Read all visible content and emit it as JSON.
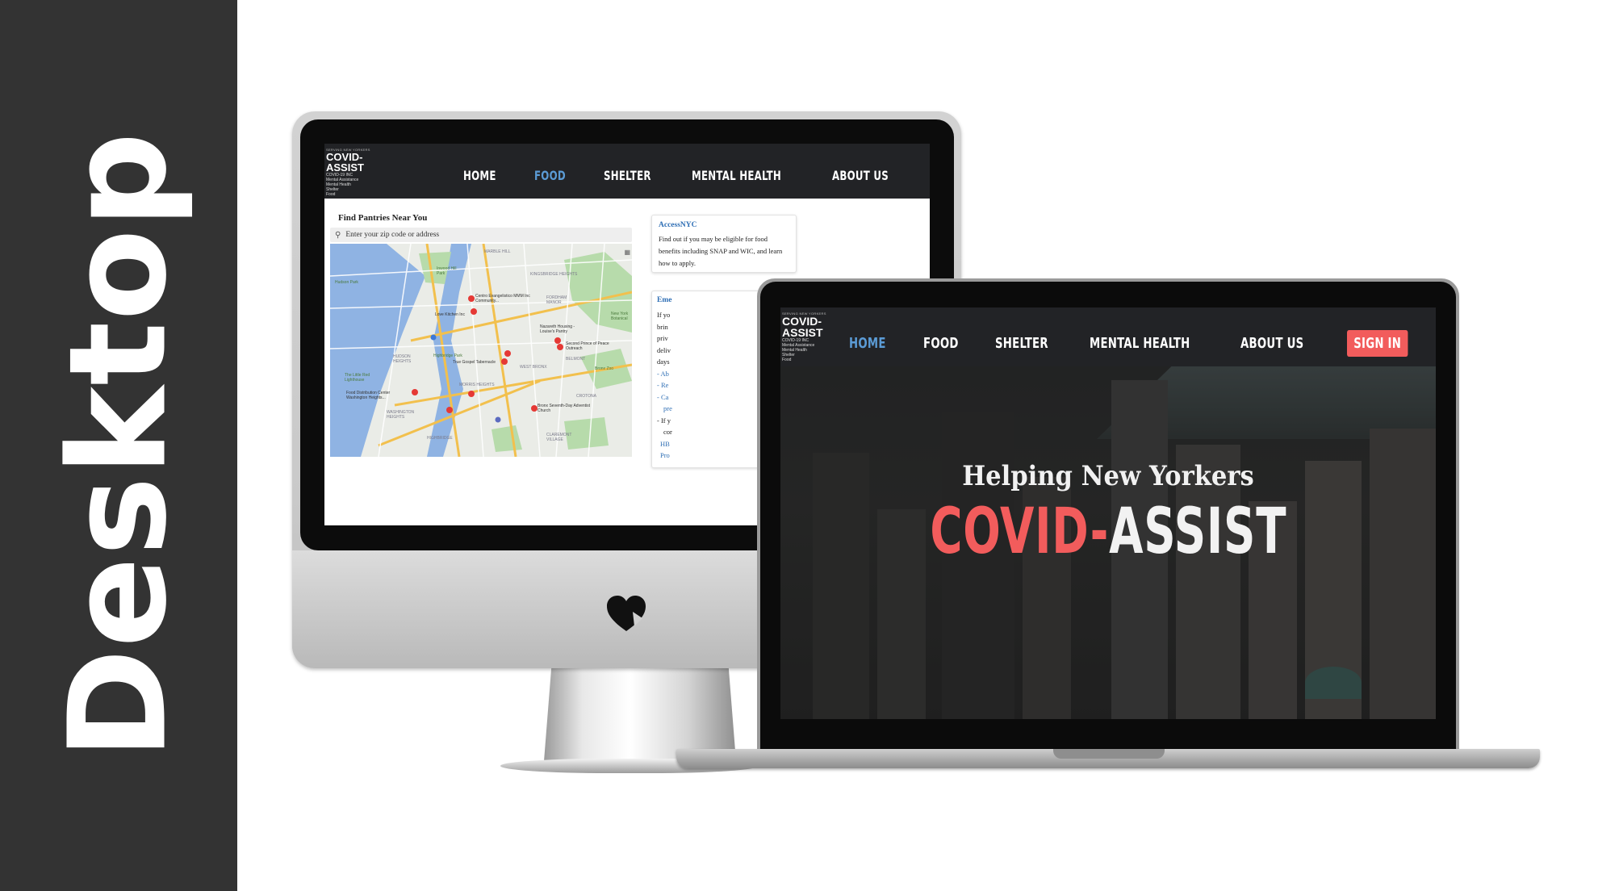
{
  "side_label": "Desktop",
  "colors": {
    "accent": "#f25c5c",
    "link": "#2f6fb5",
    "active_nav": "#5b9bd5",
    "nav_bg": "#222326",
    "band": "#333333"
  },
  "brand": {
    "tagline_top": "SERVING NEW YORKERS",
    "line1": "COVID-",
    "line2": "ASSIST",
    "line3": "COVID-19 INC",
    "small_lines": [
      "Mental Assistance",
      "Mental Health",
      "Shelter",
      "Food"
    ]
  },
  "imac": {
    "nav": [
      "HOME",
      "FOOD",
      "SHELTER",
      "MENTAL HEALTH",
      "ABOUT US"
    ],
    "active_nav": "FOOD",
    "find_title": "Find Pantries Near You",
    "search_placeholder": "Enter your zip code or address",
    "search_icon": "search-icon",
    "map_labels": [
      "MARBLE HILL",
      "Inwood Hill Park",
      "Hudson Park",
      "KINGSBRIDGE HEIGHTS",
      "FORDHAM MANOR",
      "Centro Evangelistico MMM Inc Community...",
      "Love Kitchen Inc",
      "Nazareth Housing - Louise's Pantry",
      "Second Prince of Peace Outreach",
      "New York Botanical",
      "HUDSON HEIGHTS",
      "Highbridge Park",
      "True Gospel Tabernacle",
      "WEST BRONX",
      "BELMONT",
      "Bronx Zoo",
      "The Little Red Lighthouse",
      "Food Distribution Center Washington Heights...",
      "MORRIS HEIGHTS",
      "CROTONA",
      "WASHINGTON HEIGHTS",
      "Bronx Seventh-Day Adventist Church",
      "HIGHBRIDGE",
      "CLAREMONT VILLAGE"
    ],
    "card1": {
      "title": "AccessNYC",
      "text": "Find out if you may be eligible for food benefits including SNAP and WIC, and learn how to apply."
    },
    "card2": {
      "title": "Eme",
      "lines": [
        "If yo",
        "brin",
        "priv",
        "deliv",
        "days"
      ],
      "links": [
        "- Ab",
        "- Re",
        "- Ca",
        "pre",
        "- If y",
        "cor",
        "HB",
        "Pro"
      ]
    }
  },
  "laptop": {
    "nav": [
      "HOME",
      "FOOD",
      "SHELTER",
      "MENTAL HEALTH",
      "ABOUT US"
    ],
    "active_nav": "HOME",
    "sign_in": "SIGN IN",
    "hero_subtitle": "Helping New Yorkers",
    "hero_title_part1": "COVID-",
    "hero_title_part2": "ASSIST"
  },
  "imac_logo_icon": "heart-logo-icon"
}
